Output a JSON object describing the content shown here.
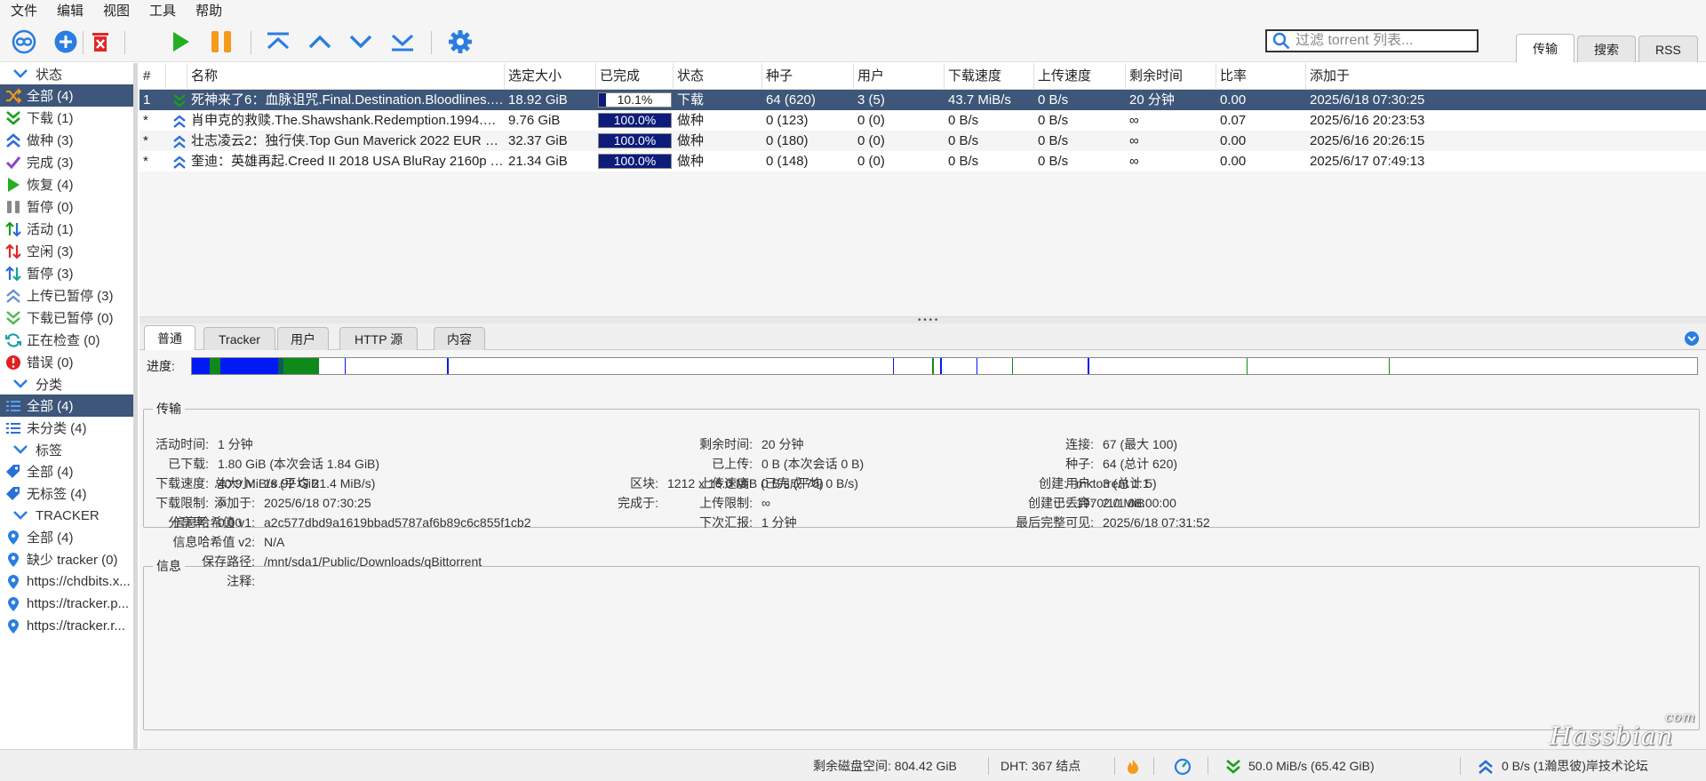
{
  "menu": [
    "文件",
    "编辑",
    "视图",
    "工具",
    "帮助"
  ],
  "search": {
    "placeholder": "过滤 torrent 列表..."
  },
  "right_tabs": [
    "传输",
    "搜索",
    "RSS"
  ],
  "sidebar": {
    "status_header": "状态",
    "status": [
      "全部 (4)",
      "下载 (1)",
      "做种 (3)",
      "完成 (3)",
      "恢复 (4)",
      "暂停 (0)",
      "活动 (1)",
      "空闲 (3)",
      "暂停 (3)",
      "上传已暂停 (3)",
      "下载已暂停 (0)",
      "正在检查 (0)",
      "错误 (0)"
    ],
    "category_header": "分类",
    "categories": [
      "全部 (4)",
      "未分类 (4)"
    ],
    "tag_header": "标签",
    "tags": [
      "全部 (4)",
      "无标签 (4)"
    ],
    "tracker_header": "TRACKER",
    "trackers": [
      "全部 (4)",
      "缺少 tracker (0)",
      "https://chdbits.x...",
      "https://tracker.p...",
      "https://tracker.r..."
    ]
  },
  "columns": [
    "#",
    "",
    "名称",
    "选定大小",
    "已完成",
    "状态",
    "种子",
    "用户",
    "下载速度",
    "上传速度",
    "剩余时间",
    "比率",
    "添加于"
  ],
  "torrents": [
    {
      "num": "1",
      "name": "死神来了6：血脉诅咒.Final.Destination.Bloodlines.2025.2160p...",
      "size": "18.92 GiB",
      "progress": 0.101,
      "progress_text": "10.1%",
      "status": "下载",
      "seeds": "64 (620)",
      "peers": "3 (5)",
      "dl": "43.7 MiB/s",
      "ul": "0 B/s",
      "eta": "20 分钟",
      "ratio": "0.00",
      "added": "2025/6/18 07:30:25"
    },
    {
      "num": "*",
      "name": "肖申克的救赎.The.Shawshank.Redemption.1994.Bluray.1080p...",
      "size": "9.76 GiB",
      "progress": 1.0,
      "progress_text": "100.0%",
      "status": "做种",
      "seeds": "0 (123)",
      "peers": "0 (0)",
      "dl": "0 B/s",
      "ul": "0 B/s",
      "eta": "∞",
      "ratio": "0.07",
      "added": "2025/6/16 20:23:53"
    },
    {
      "num": "*",
      "name": "壮志凌云2：独行侠.Top Gun Maverick 2022 EUR BluRay 2160...",
      "size": "32.37 GiB",
      "progress": 1.0,
      "progress_text": "100.0%",
      "status": "做种",
      "seeds": "0 (180)",
      "peers": "0 (0)",
      "dl": "0 B/s",
      "ul": "0 B/s",
      "eta": "∞",
      "ratio": "0.00",
      "added": "2025/6/16 20:26:15"
    },
    {
      "num": "*",
      "name": "奎迪：英雄再起.Creed II 2018 USA BluRay 2160p TrueHD7.1 ...",
      "size": "21.34 GiB",
      "progress": 1.0,
      "progress_text": "100.0%",
      "status": "做种",
      "seeds": "0 (148)",
      "peers": "0 (0)",
      "dl": "0 B/s",
      "ul": "0 B/s",
      "eta": "∞",
      "ratio": "0.00",
      "added": "2025/6/17 07:49:13"
    }
  ],
  "detail_tabs": [
    "普通",
    "Tracker",
    "用户",
    "HTTP 源",
    "内容"
  ],
  "progress_label": "进度:",
  "transfer": {
    "title": "传输",
    "rows": [
      [
        "活动时间:",
        "1 分钟",
        "剩余时间:",
        "20 分钟",
        "连接:",
        "67 (最大 100)"
      ],
      [
        "已下载:",
        "1.80 GiB (本次会话 1.84 GiB)",
        "已上传:",
        "0 B (本次会话 0 B)",
        "种子:",
        "64 (总计 620)"
      ],
      [
        "下载速度:",
        "40.9 MiB/s (平均 21.4 MiB/s)",
        "上传速度:",
        "0 B/s (平均 0 B/s)",
        "用户:",
        "3 (总计 5)"
      ],
      [
        "下载限制:",
        "∞",
        "上传限制:",
        "∞",
        "已丢弃:",
        "2.0 MiB"
      ],
      [
        "分享率:",
        "0.00",
        "下次汇报:",
        "1 分钟",
        "最后完整可见:",
        "2025/6/18 07:31:52"
      ]
    ]
  },
  "info": {
    "title": "信息",
    "left": [
      [
        "总大小:",
        "18.92 GiB"
      ],
      [
        "添加于:",
        "2025/6/18 07:30:25"
      ],
      [
        "信息哈希值 v1:",
        "a2c577dbd9a1619bbad5787af6b89c6c855f1cb2"
      ],
      [
        "信息哈希值 v2:",
        "N/A"
      ],
      [
        "保存路径:",
        "/mnt/sda1/Public/Downloads/qBittorrent"
      ],
      [
        "注释:",
        ""
      ]
    ],
    "mid": [
      [
        "区块:",
        "1212 x 16.0 MiB (已完成 78)"
      ],
      [
        "完成于:",
        ""
      ]
    ],
    "right": [
      [
        "创建:",
        "mktorrent 1.1"
      ],
      [
        "创建于:",
        "1970/1/1 08:00:00"
      ]
    ]
  },
  "status": {
    "disk": "剩余磁盘空间: 804.42 GiB",
    "dht": "DHT: 367 结点",
    "dl": "50.0 MiB/s (65.42 GiB)",
    "ul": "0 B/s (1瀚思彼)岸技术论坛"
  },
  "watermark": {
    "main": "Hassbian",
    "com": "com"
  },
  "colors": {
    "selection": "#3d5679",
    "progress_fill": "#0d1b7a",
    "pieces_blue": "#0019f5",
    "pieces_green": "#0f8a1a",
    "accent": "#2a7de1"
  }
}
